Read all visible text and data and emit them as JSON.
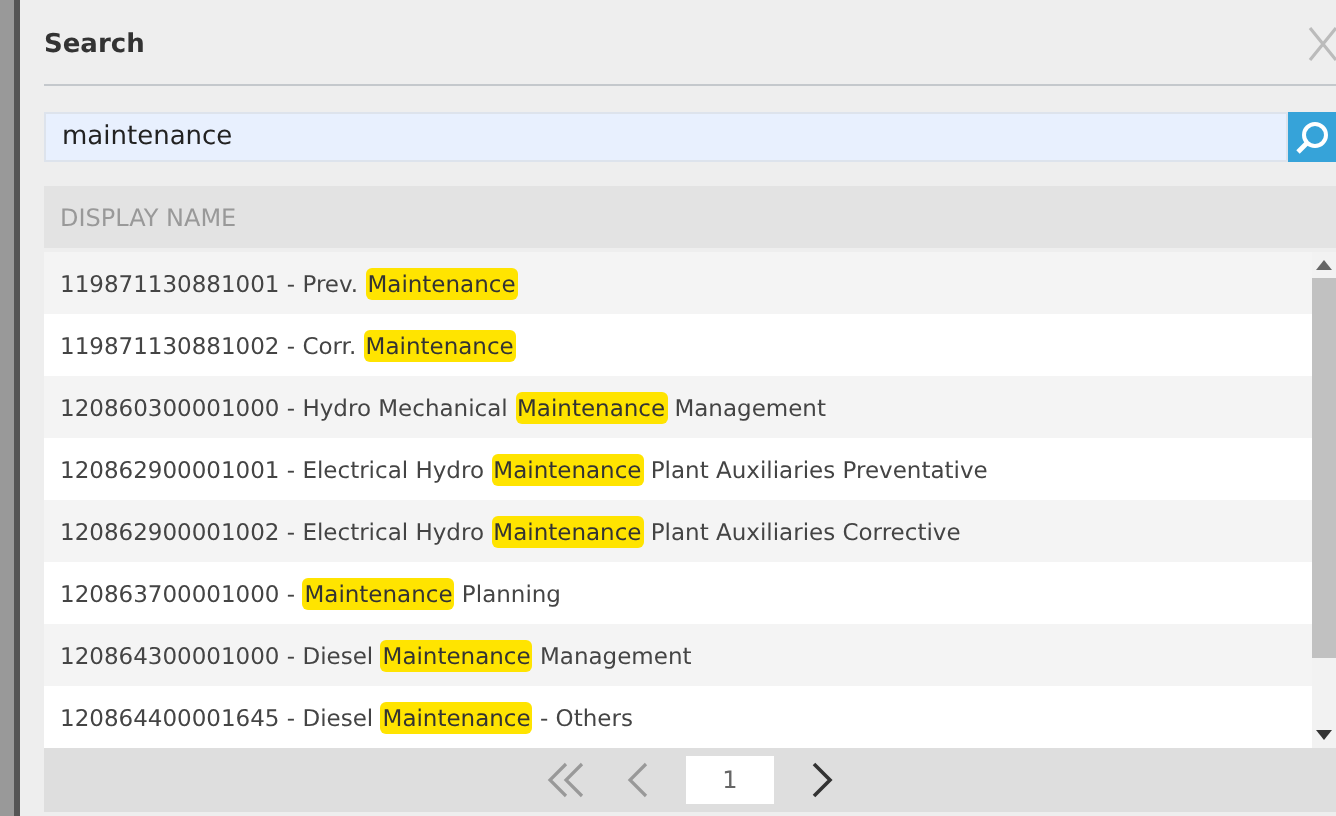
{
  "dialog": {
    "title": "Search"
  },
  "search": {
    "value": "maintenance"
  },
  "table": {
    "columns": [
      "DISPLAY NAME"
    ],
    "rows": [
      {
        "before": "119871130881001 - Prev. ",
        "match": "Maintenance",
        "after": ""
      },
      {
        "before": "119871130881002 - Corr. ",
        "match": "Maintenance",
        "after": ""
      },
      {
        "before": "120860300001000 - Hydro Mechanical ",
        "match": "Maintenance",
        "after": " Management"
      },
      {
        "before": "120862900001001 - Electrical Hydro ",
        "match": "Maintenance",
        "after": " Plant Auxiliaries Preventative"
      },
      {
        "before": "120862900001002 - Electrical Hydro ",
        "match": "Maintenance",
        "after": " Plant Auxiliaries Corrective"
      },
      {
        "before": "120863700001000 - ",
        "match": "Maintenance",
        "after": " Planning"
      },
      {
        "before": "120864300001000 - Diesel ",
        "match": "Maintenance",
        "after": " Management"
      },
      {
        "before": "120864400001645 - Diesel ",
        "match": "Maintenance",
        "after": " - Others"
      }
    ]
  },
  "pager": {
    "buttons": [
      {
        "kind": "first",
        "disabled": true
      },
      {
        "kind": "prev",
        "disabled": true
      },
      {
        "kind": "page",
        "label": "1"
      },
      {
        "kind": "next",
        "disabled": false
      }
    ]
  }
}
